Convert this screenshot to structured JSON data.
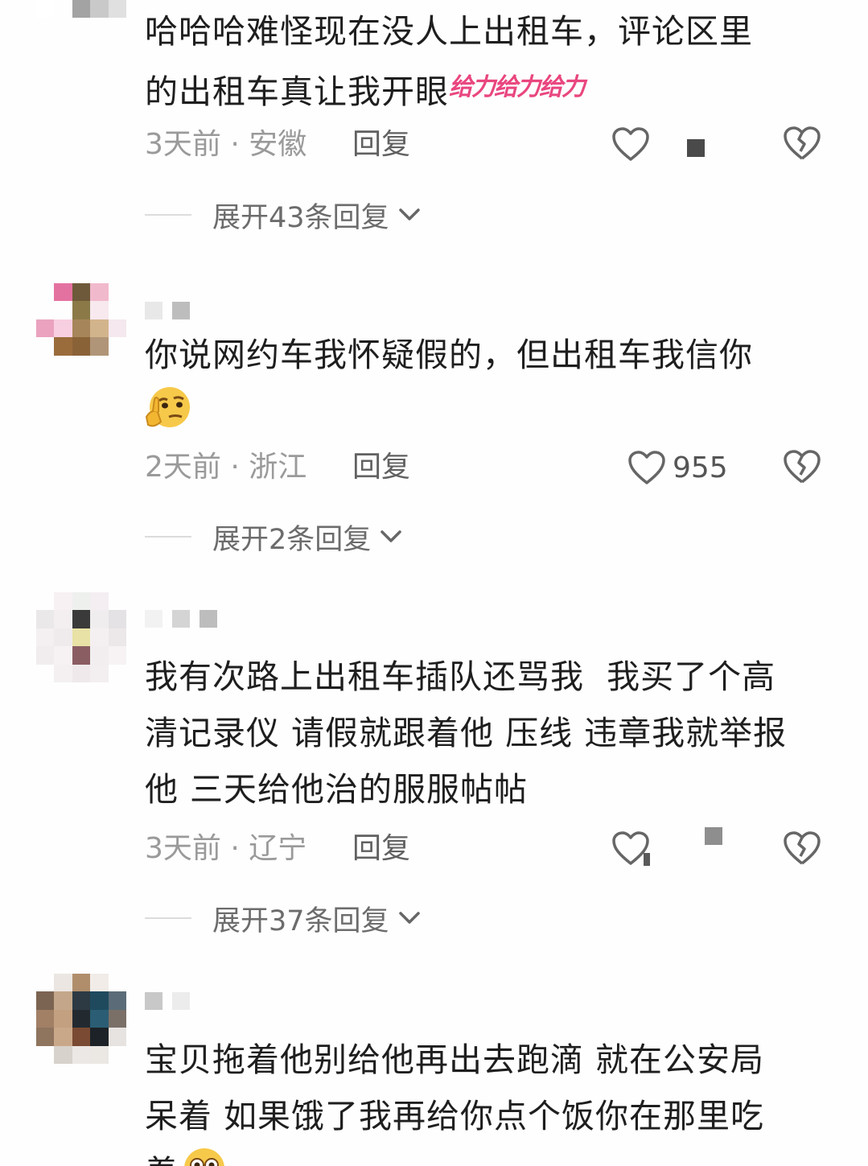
{
  "comments": [
    {
      "text": "哈哈哈难怪现在没人上出租车，评论区里\n的出租车真让我开眼",
      "sticker": "给力给力给力",
      "time": "3天前 · 安徽",
      "reply": "回复",
      "likes": "",
      "expand": "展开43条回复"
    },
    {
      "text": "你说网约车我怀疑假的，但出租车我信你",
      "emoji": "thinking-face-emoji",
      "time": "2天前 · 浙江",
      "reply": "回复",
      "likes": "955",
      "expand": "展开2条回复"
    },
    {
      "text": "我有次路上出租车插队还骂我  我买了个高\n清记录仪 请假就跟着他 压线 违章我就举报\n他 三天给他治的服服帖帖",
      "time": "3天前 · 辽宁",
      "reply": "回复",
      "likes": "",
      "expand": "展开37条回复"
    },
    {
      "text": "宝贝拖着他别给他再出去跑滴 就在公安局\n呆着 如果饿了我再给你点个饭你在那里吃\n着",
      "emoji": "flushed-face-emoji"
    }
  ],
  "icons": {
    "like": "heart-outline-icon",
    "dislike": "broken-heart-icon",
    "expand": "chevron-down-icon"
  },
  "colors": {
    "accent": "#e9467f",
    "meta": "#9a9a9a",
    "text": "#1e1e1e"
  }
}
